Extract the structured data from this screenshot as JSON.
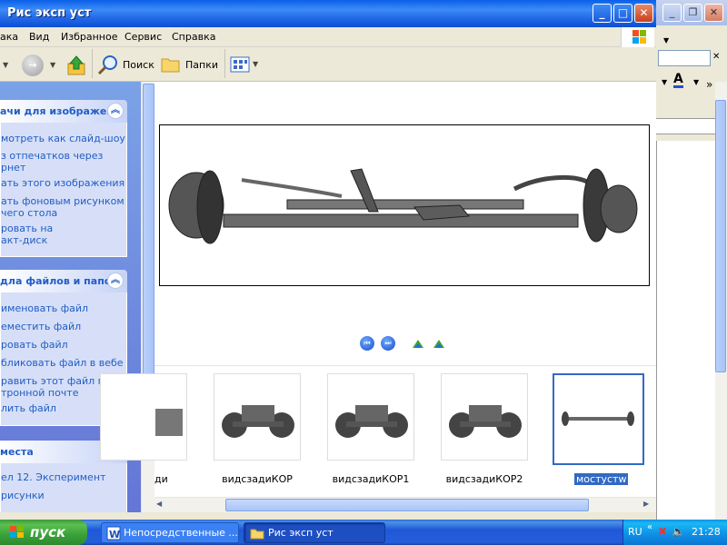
{
  "window": {
    "title": "Рис эксп уст"
  },
  "menu": [
    "ака",
    "Вид",
    "Избранное",
    "Сервис",
    "Справка"
  ],
  "toolbar": {
    "search": "Поиск",
    "folders": "Папки"
  },
  "taskpane": {
    "image_tasks": {
      "title": "ачи для изображени",
      "items": [
        "мотреть как слайд-шоу",
        "з отпечатков через\nрнет",
        "ать этого изображения",
        "ать фоновым рисунком\nчего стола",
        "ровать на\nакт-диск"
      ]
    },
    "file_tasks": {
      "title": "дла файлов и папок",
      "items": [
        "именовать файл",
        "еместить файл",
        "ровать файл",
        "бликовать файл в вебе",
        "равить этот файл по\nтронной почте",
        "лить файл"
      ]
    },
    "places": {
      "title": "места",
      "items": [
        "ел 12. Эксперимент",
        "рисунки"
      ]
    }
  },
  "filmstrip": [
    {
      "label": "ди",
      "selected": false
    },
    {
      "label": "видсзадиКОР",
      "selected": false
    },
    {
      "label": "видсзадиКОР1",
      "selected": false
    },
    {
      "label": "видсзадиКОР2",
      "selected": false
    },
    {
      "label": "мостустw",
      "selected": true
    }
  ],
  "taskbar": {
    "start": "пуск",
    "buttons": [
      {
        "label": "Непосредственные ...",
        "icon": "word-icon"
      },
      {
        "label": "Рис эксп уст",
        "icon": "folder-icon"
      }
    ],
    "lang": "RU",
    "clock": "21:28"
  }
}
